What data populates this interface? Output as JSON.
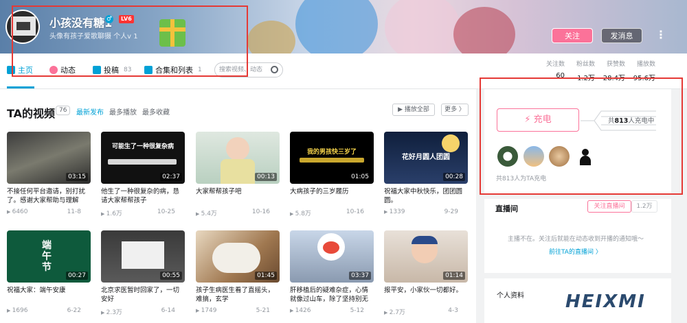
{
  "profile": {
    "username": "小孩没有糖1",
    "level_badge": "LV6",
    "signature": "头像有孩子爱歌聊摄 个人ⅴ 1",
    "follow_label": "关注",
    "message_label": "发消息",
    "more_label": "⋮"
  },
  "nav": {
    "items": [
      {
        "label": "主页",
        "count": ""
      },
      {
        "label": "动态",
        "count": ""
      },
      {
        "label": "投稿",
        "count": "83"
      },
      {
        "label": "合集和列表",
        "count": "1"
      }
    ],
    "search_placeholder": "搜索视频、动态"
  },
  "stats": [
    {
      "label": "关注数",
      "value": "60"
    },
    {
      "label": "粉丝数",
      "value": "1.2万"
    },
    {
      "label": "获赞数",
      "value": "28.4万"
    },
    {
      "label": "播放数",
      "value": "95.6万"
    }
  ],
  "videos": {
    "title": "TA的视频",
    "count": "76",
    "sort": [
      "最新发布",
      "最多播放",
      "最多收藏"
    ],
    "play_all": "▶ 播放全部",
    "more": "更多 〉",
    "items": [
      {
        "title": "不接任何平台邀请，别打扰了。感谢大家帮助与理解",
        "duration": "03:15",
        "plays": "6460",
        "date": "11-8",
        "thumb_text": ""
      },
      {
        "title": "他生了一种很复杂的病，恳请大家帮帮孩子",
        "duration": "02:37",
        "plays": "1.6万",
        "date": "10-25",
        "thumb_text": "可能生了一种很复杂病"
      },
      {
        "title": "大家帮帮孩子吧",
        "duration": "00:13",
        "plays": "5.4万",
        "date": "10-16",
        "thumb_text": ""
      },
      {
        "title": "大病孩子的三岁履历",
        "duration": "01:05",
        "plays": "5.8万",
        "date": "10-16",
        "thumb_text": "我的男孩快三岁了"
      },
      {
        "title": "祝福大家中秋快乐，团团圆圆。",
        "duration": "00:28",
        "plays": "1339",
        "date": "9-29",
        "thumb_text": "花好月圆人团圆"
      },
      {
        "title": "祝福大家：端午安康",
        "duration": "00:27",
        "plays": "1696",
        "date": "6-22",
        "thumb_text": "端午节"
      },
      {
        "title": "北京求医暂时回家了，一切安好",
        "duration": "00:55",
        "plays": "2.3万",
        "date": "6-14",
        "thumb_text": ""
      },
      {
        "title": "孩子生病医生看了直摇头，难搞，玄学",
        "duration": "01:45",
        "plays": "1749",
        "date": "5-21",
        "thumb_text": ""
      },
      {
        "title": "肝移植后的疑难杂症，心情就像过山车，除了坚持别无选择",
        "duration": "03:37",
        "plays": "1426",
        "date": "5-12",
        "thumb_text": ""
      },
      {
        "title": "报平安，小家伙一切都好。",
        "duration": "01:14",
        "plays": "2.7万",
        "date": "4-3",
        "thumb_text": ""
      }
    ]
  },
  "charge": {
    "button_label": "充电",
    "info_prefix": "共",
    "info_count": "813",
    "info_suffix": "人充电中",
    "footer": "共813人为TA充电"
  },
  "live": {
    "title": "直播间",
    "follow_label": "关注直播间",
    "count": "1.2万",
    "desc": "主播不在。关注后就能在动态收到开播的通知哦～",
    "link": "前往TA的直播间 〉"
  },
  "personal": {
    "title": "个人资料"
  },
  "watermark": "HEIXMI",
  "colors": {
    "accent_blue": "#00a1d6",
    "accent_pink": "#fb7299",
    "highlight_red": "#e53935"
  }
}
